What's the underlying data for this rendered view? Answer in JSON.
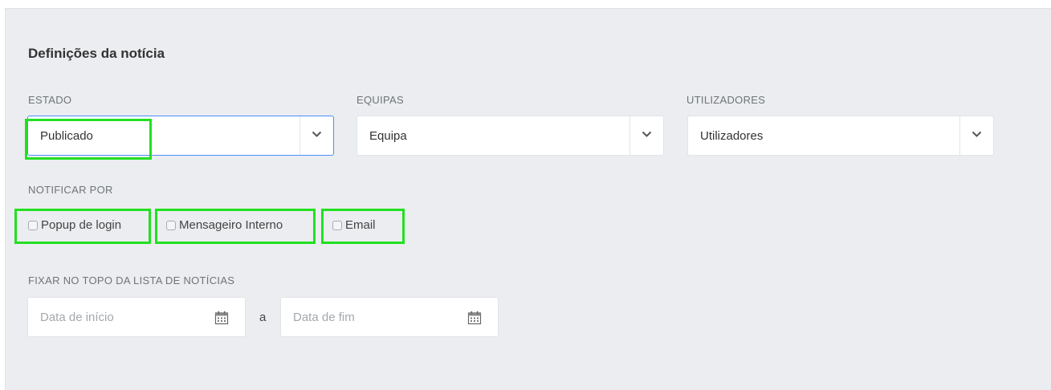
{
  "section_title": "Definições da notícia",
  "estado": {
    "label": "ESTADO",
    "value": "Publicado"
  },
  "equipas": {
    "label": "EQUIPAS",
    "value": "Equipa"
  },
  "utilizadores": {
    "label": "UTILIZADORES",
    "value": "Utilizadores"
  },
  "notificar": {
    "label": "NOTIFICAR POR",
    "options": [
      {
        "label": "Popup de login",
        "checked": false
      },
      {
        "label": "Mensageiro Interno",
        "checked": false
      },
      {
        "label": "Email",
        "checked": false
      }
    ]
  },
  "fixar": {
    "label": "FIXAR NO TOPO DA LISTA DE NOTÍCIAS",
    "start_placeholder": "Data de início",
    "separator": "a",
    "end_placeholder": "Data de fim"
  },
  "icons": {
    "dropdown": "chevron-down-icon",
    "date": "calendar-icon"
  },
  "colors": {
    "highlight": "#22e022",
    "focus_border": "#4d90fe",
    "panel_bg": "#ebedf0"
  }
}
